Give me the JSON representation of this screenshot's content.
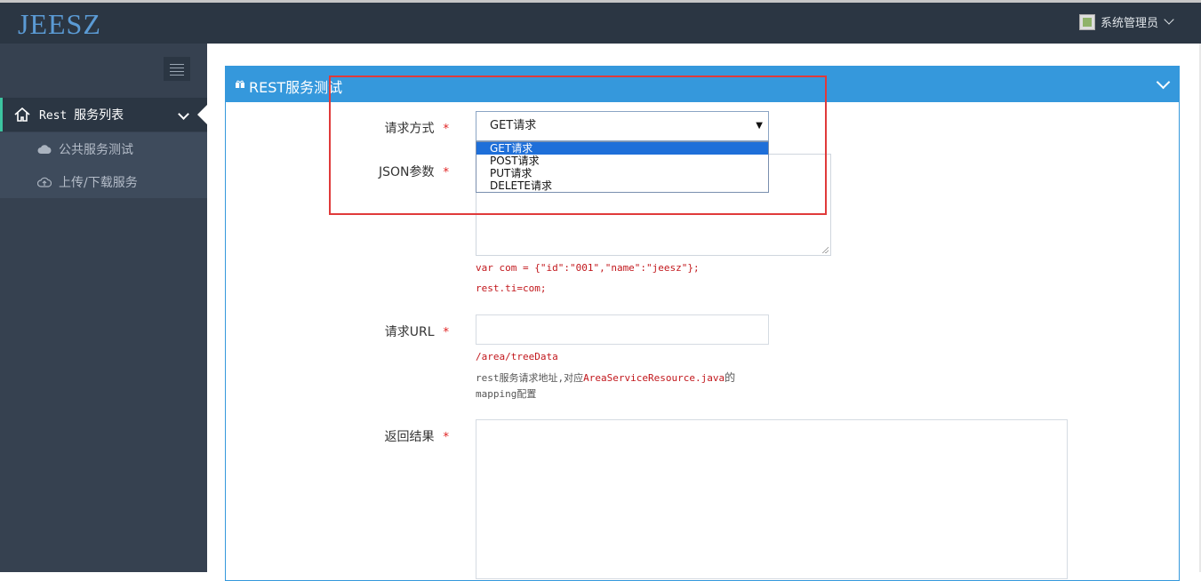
{
  "app": {
    "logo": "JEESZ"
  },
  "header": {
    "user_name": "系统管理员"
  },
  "sidebar": {
    "root": {
      "label_prefix": "Rest ",
      "label": "服务列表"
    },
    "items": [
      {
        "label": "公共服务测试",
        "icon": "cloud-icon"
      },
      {
        "label": "上传/下载服务",
        "icon": "cloud-upload-icon"
      }
    ]
  },
  "panel": {
    "title": "REST服务测试"
  },
  "form": {
    "method": {
      "label": "请求方式",
      "required_mark": "*",
      "value": "GET请求",
      "options": [
        "GET请求",
        "POST请求",
        "PUT请求",
        "DELETE请求"
      ]
    },
    "json": {
      "label": "JSON参数",
      "required_mark": "*",
      "hint_line1": "var com = {\"id\":\"001\",\"name\":\"jeesz\"};",
      "hint_line2": "rest.ti=com;"
    },
    "url": {
      "label": "请求URL",
      "required_mark": "*",
      "example": "/area/treeData",
      "desc_prefix": "rest服务请求地址,对应",
      "desc_class": "AreaServiceResource.java",
      "desc_suffix": "的",
      "desc_line2": "mapping配置"
    },
    "result": {
      "label": "返回结果",
      "required_mark": "*"
    }
  },
  "colors": {
    "navbar": "#2b3643",
    "sidebar": "#364150",
    "accent": "#3598dc",
    "annotation": "#e03a3a",
    "required": "#e02222"
  }
}
